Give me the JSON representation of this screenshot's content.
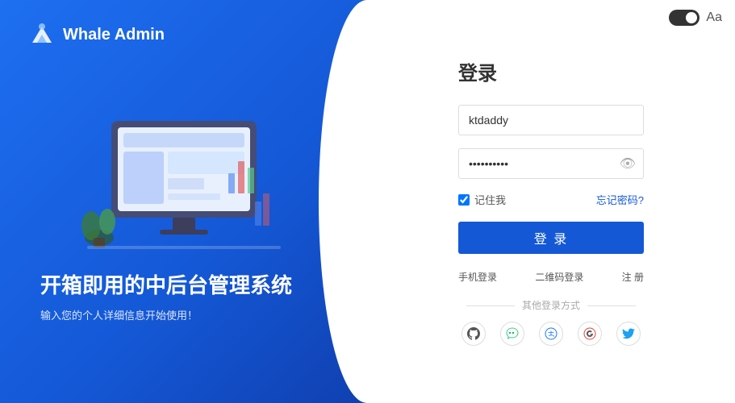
{
  "app": {
    "logo_text": "Whale Admin",
    "tagline": "开箱即用的中后台管理系统",
    "tagline_sub": "输入您的个人详细信息开始使用！"
  },
  "form": {
    "title": "登录",
    "username_placeholder": "ktdaddy",
    "password_placeholder": "••••••••••",
    "remember_label": "记住我",
    "forgot_label": "忘记密码?",
    "login_btn": "登 录",
    "alt_phone": "手机登录",
    "alt_qr": "二维码登录",
    "alt_register": "注 册",
    "other_label": "其他登录方式"
  },
  "topbar": {
    "lang_icon": "Aа"
  },
  "social": [
    {
      "name": "github",
      "symbol": "⊙"
    },
    {
      "name": "wechat",
      "symbol": "⊛"
    },
    {
      "name": "alipay",
      "symbol": "◎"
    },
    {
      "name": "google",
      "symbol": "◉"
    },
    {
      "name": "twitter",
      "symbol": "⊚"
    }
  ]
}
